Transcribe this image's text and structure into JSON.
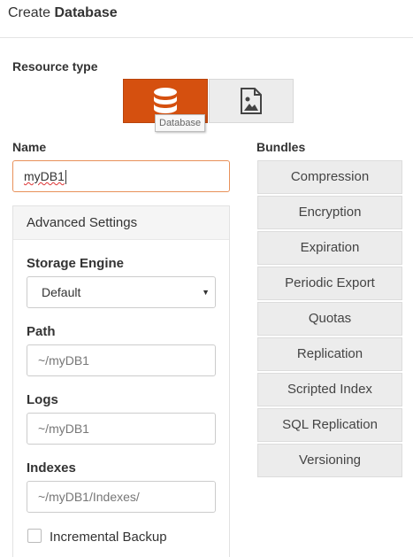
{
  "header": {
    "prefix": "Create",
    "title": "Database"
  },
  "resource_type": {
    "label": "Resource type",
    "buttons": [
      {
        "icon": "database-icon",
        "selected": true
      },
      {
        "icon": "image-file-icon",
        "selected": false
      }
    ],
    "tooltip": "Database",
    "accent_color": "#d5500f"
  },
  "name": {
    "label": "Name",
    "value": "myDB1"
  },
  "advanced": {
    "title": "Advanced Settings",
    "storage_engine": {
      "label": "Storage Engine",
      "selected": "Default"
    },
    "path": {
      "label": "Path",
      "placeholder": "~/myDB1"
    },
    "logs": {
      "label": "Logs",
      "placeholder": "~/myDB1"
    },
    "indexes": {
      "label": "Indexes",
      "placeholder": "~/myDB1/Indexes/"
    },
    "incremental_backup": {
      "label": "Incremental Backup",
      "checked": false
    }
  },
  "bundles": {
    "label": "Bundles",
    "items": [
      "Compression",
      "Encryption",
      "Expiration",
      "Periodic Export",
      "Quotas",
      "Replication",
      "Scripted Index",
      "SQL Replication",
      "Versioning"
    ]
  }
}
